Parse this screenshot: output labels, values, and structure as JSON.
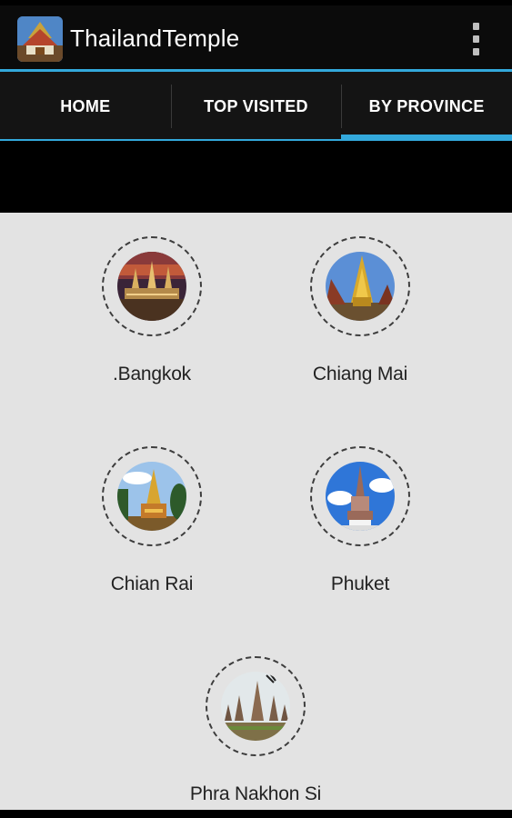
{
  "app": {
    "title": "ThailandTemple",
    "icon": "temple-app-icon",
    "menu_icon": "overflow-menu-icon"
  },
  "tabs": [
    {
      "label": "HOME",
      "active": false
    },
    {
      "label": "TOP VISITED",
      "active": false
    },
    {
      "label": "BY PROVINCE",
      "active": true
    }
  ],
  "provinces": [
    {
      "name": ".Bangkok",
      "image": "bangkok-temple-photo"
    },
    {
      "name": "Chiang Mai",
      "image": "chiang-mai-temple-photo"
    },
    {
      "name": "Chian Rai",
      "image": "chiang-rai-temple-photo"
    },
    {
      "name": "Phuket",
      "image": "phuket-temple-photo"
    },
    {
      "name": "Phra Nakhon Si",
      "image": "phra-nakhon-si-temple-photo"
    }
  ],
  "colors": {
    "accent": "#33a9dc",
    "action_bar": "#0b0b0b",
    "tab_bar": "#141414",
    "content_bg": "#e3e3e3",
    "label_text": "#222222"
  }
}
